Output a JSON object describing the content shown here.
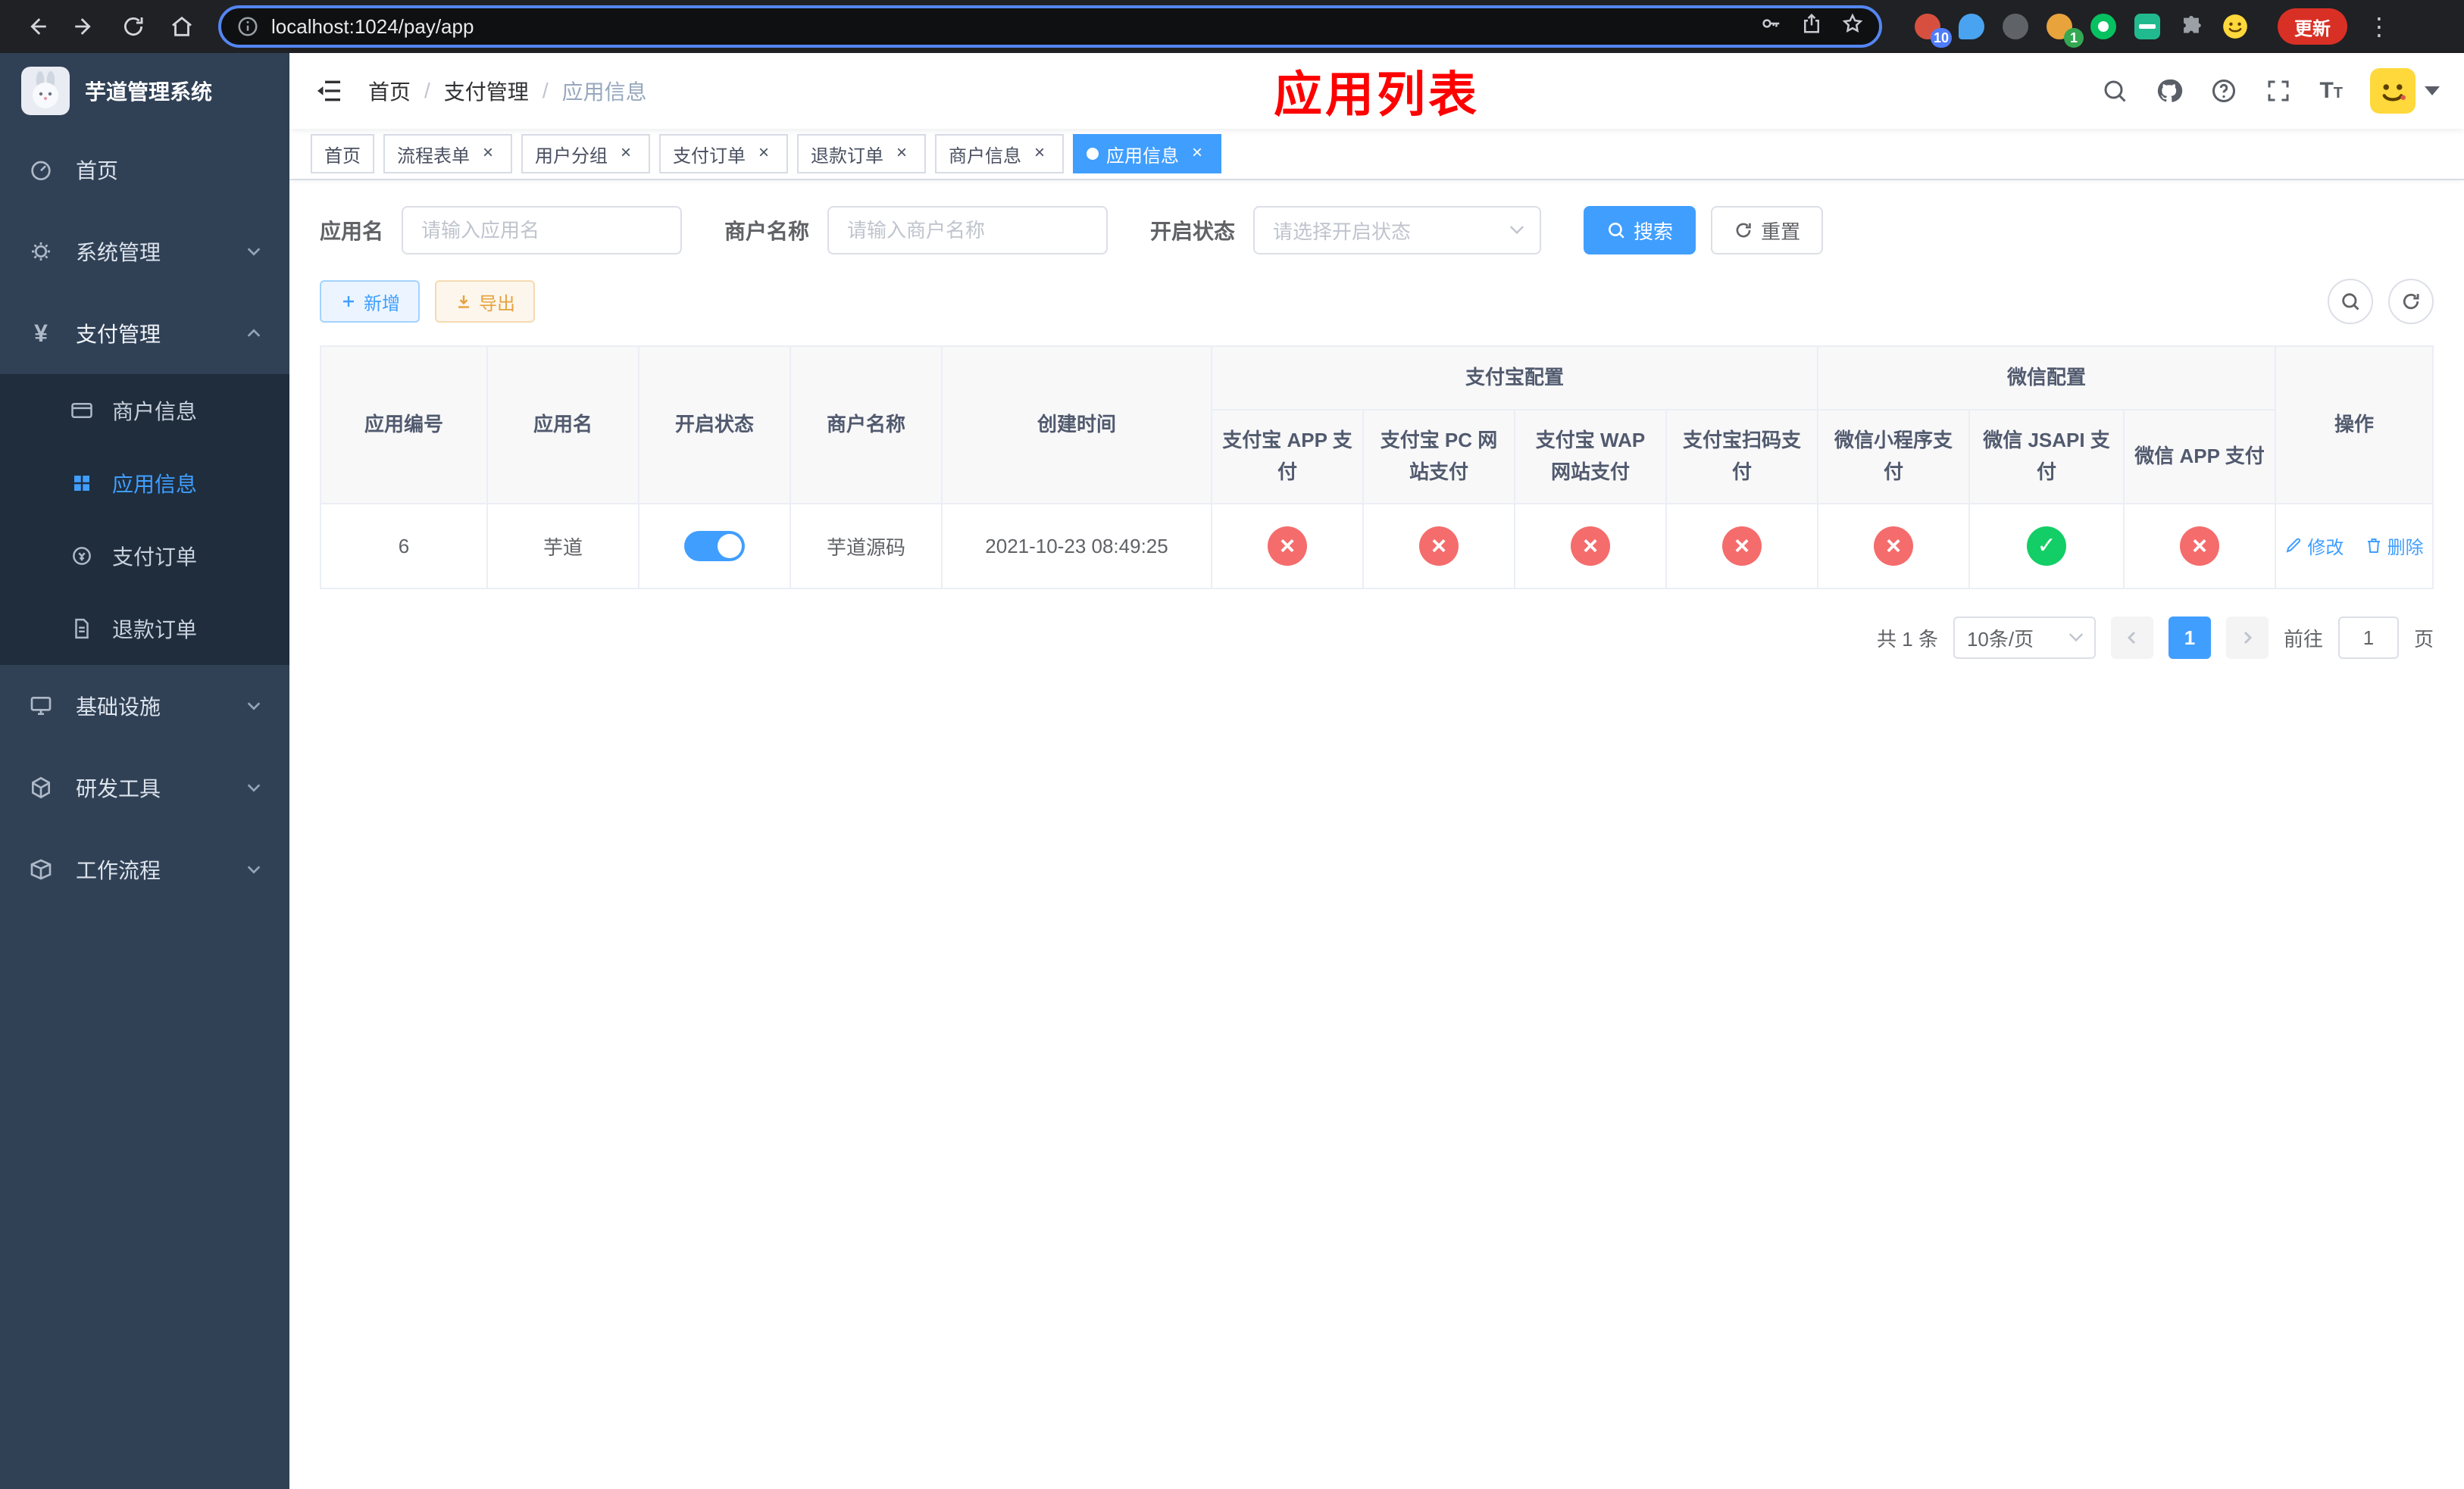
{
  "browser": {
    "url": "localhost:1024/pay/app",
    "update_label": "更新",
    "ext_badge_1": "10",
    "ext_badge_2": "1"
  },
  "sidebar": {
    "title": "芋道管理系统",
    "menu": [
      {
        "label": "首页"
      },
      {
        "label": "系统管理"
      },
      {
        "label": "支付管理"
      },
      {
        "label": "基础设施"
      },
      {
        "label": "研发工具"
      },
      {
        "label": "工作流程"
      }
    ],
    "submenu": [
      {
        "label": "商户信息"
      },
      {
        "label": "应用信息"
      },
      {
        "label": "支付订单"
      },
      {
        "label": "退款订单"
      }
    ]
  },
  "navbar": {
    "breadcrumb": [
      "首页",
      "支付管理",
      "应用信息"
    ],
    "page_title": "应用列表"
  },
  "tabs": [
    {
      "label": "首页"
    },
    {
      "label": "流程表单"
    },
    {
      "label": "用户分组"
    },
    {
      "label": "支付订单"
    },
    {
      "label": "退款订单"
    },
    {
      "label": "商户信息"
    },
    {
      "label": "应用信息"
    }
  ],
  "search": {
    "app_name_label": "应用名",
    "app_name_placeholder": "请输入应用名",
    "merchant_label": "商户名称",
    "merchant_placeholder": "请输入商户名称",
    "status_label": "开启状态",
    "status_placeholder": "请选择开启状态",
    "search_button": "搜索",
    "reset_button": "重置"
  },
  "toolbar": {
    "add": "新增",
    "export": "导出"
  },
  "table": {
    "groups": {
      "alipay": "支付宝配置",
      "wechat": "微信配置"
    },
    "headers": {
      "id": "应用编号",
      "name": "应用名",
      "status": "开启状态",
      "merchant": "商户名称",
      "created": "创建时间",
      "alipay_app": "支付宝 APP 支付",
      "alipay_pc": "支付宝 PC 网站支付",
      "alipay_wap": "支付宝 WAP 网站支付",
      "alipay_qr": "支付宝扫码支付",
      "wechat_lite": "微信小程序支付",
      "wechat_jsapi": "微信 JSAPI 支付",
      "wechat_app": "微信 APP 支付",
      "actions": "操作"
    },
    "row": {
      "id": "6",
      "name": "芋道",
      "enabled": true,
      "merchant": "芋道源码",
      "created": "2021-10-23 08:49:25",
      "configs": {
        "alipay_app": false,
        "alipay_pc": false,
        "alipay_wap": false,
        "alipay_qr": false,
        "wechat_lite": false,
        "wechat_jsapi": true,
        "wechat_app": false
      },
      "edit": "修改",
      "delete": "删除"
    }
  },
  "pagination": {
    "total": "共 1 条",
    "page_size": "10条/页",
    "page": "1",
    "goto": "前往",
    "goto_value": "1",
    "unit": "页"
  },
  "colors": {
    "accent": "#409eff",
    "danger": "#f56c6c",
    "success": "#13ce66",
    "warning": "#e6a23c",
    "title_red": "#fe0000",
    "sidebar_bg": "#304156",
    "submenu_bg": "#1f2d3d"
  }
}
